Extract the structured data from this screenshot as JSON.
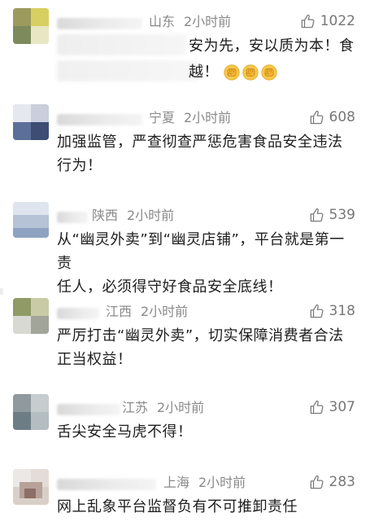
{
  "comments": [
    {
      "location": "山东",
      "time": "2小时前",
      "likes": "1022",
      "line1": "安为先，安以质为本！食",
      "line2": "越！",
      "emoji": "fist-emoji"
    },
    {
      "location": "宁夏",
      "time": "2小时前",
      "likes": "608",
      "line1": "加强监管，严查彻查严惩危害食品安全违法",
      "line2": "行为！"
    },
    {
      "location": "陕西",
      "time": "2小时前",
      "likes": "539",
      "line1": "从“幽灵外卖”到“幽灵店铺”，平台就是第一责",
      "line2": "任人，必须得守好食品安全底线！"
    },
    {
      "location": "江西",
      "time": "2小时前",
      "likes": "318",
      "line1": "严厉打击“幽灵外卖”，切实保障消费者合法",
      "line2": "正当权益！"
    },
    {
      "location": "江苏",
      "time": "2小时前",
      "likes": "307",
      "line1": "舌尖安全马虎不得！",
      "line2": ""
    },
    {
      "location": "上海",
      "time": "2小时前",
      "likes": "283",
      "line1": "网上乱象平台监督负有不可推卸责任",
      "line2": ""
    }
  ],
  "icons": {
    "like": "thumbs-up-outline-icon",
    "emoji": "raised-fist-emoji"
  },
  "colors": {
    "meta_gray": "#8a8a8a",
    "text": "#1e1e1e",
    "like_gray": "#777777",
    "fist_yellow": "#f6b93b"
  }
}
